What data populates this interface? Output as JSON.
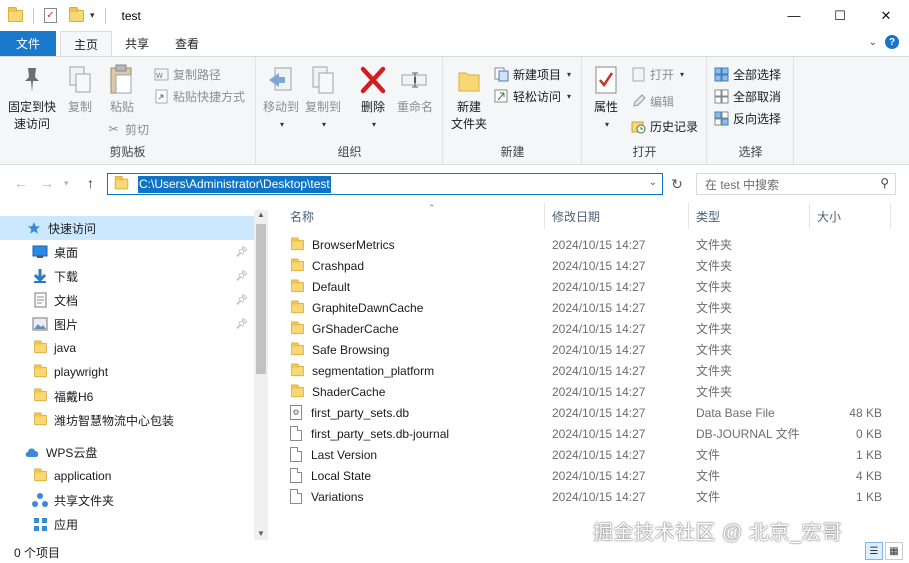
{
  "window": {
    "title": "test",
    "controls": {
      "minimize": "—",
      "maximize": "☐",
      "close": "✕"
    }
  },
  "ribbon_tabs": [
    {
      "label": "文件",
      "kind": "file"
    },
    {
      "label": "主页",
      "active": true
    },
    {
      "label": "共享"
    },
    {
      "label": "查看"
    }
  ],
  "ribbon": {
    "clipboard": {
      "group_label": "剪贴板",
      "pin_quick_access": "固定到快\n速访问",
      "copy": "复制",
      "paste": "粘贴",
      "copy_path": "复制路径",
      "paste_shortcut": "粘贴快捷方式",
      "cut": "剪切"
    },
    "organize": {
      "group_label": "组织",
      "move_to": "移动到",
      "copy_to": "复制到",
      "delete": "删除",
      "rename": "重命名"
    },
    "new": {
      "group_label": "新建",
      "new_folder": "新建\n文件夹",
      "new_item": "新建项目",
      "easy_access": "轻松访问"
    },
    "open": {
      "group_label": "打开",
      "properties": "属性",
      "open": "打开",
      "edit": "编辑",
      "history": "历史记录"
    },
    "select": {
      "group_label": "选择",
      "select_all": "全部选择",
      "select_none": "全部取消",
      "invert_selection": "反向选择"
    }
  },
  "address_bar": {
    "path": "C:\\Users\\Administrator\\Desktop\\test",
    "search_placeholder": "在 test 中搜索"
  },
  "nav_pane": {
    "items": [
      {
        "label": "快速访问",
        "icon": "star-icon",
        "selected": true,
        "indent": 0
      },
      {
        "label": "桌面",
        "icon": "desktop-icon",
        "pinned": true,
        "indent": 1
      },
      {
        "label": "下载",
        "icon": "download-icon",
        "pinned": true,
        "indent": 1
      },
      {
        "label": "文档",
        "icon": "document-icon",
        "pinned": true,
        "indent": 1
      },
      {
        "label": "图片",
        "icon": "pictures-icon",
        "pinned": true,
        "indent": 1
      },
      {
        "label": "java",
        "icon": "folder-icon",
        "indent": 1
      },
      {
        "label": "playwright",
        "icon": "folder-icon",
        "indent": 1
      },
      {
        "label": "福戴H6",
        "icon": "folder-icon",
        "indent": 1
      },
      {
        "label": "潍坊智慧物流中心包装",
        "icon": "folder-icon",
        "indent": 1
      },
      {
        "label": "WPS云盘",
        "icon": "cloud-icon",
        "indent": 0
      },
      {
        "label": "application",
        "icon": "folder-icon",
        "indent": 1
      },
      {
        "label": "共享文件夹",
        "icon": "share-folder-icon",
        "indent": 1
      },
      {
        "label": "应用",
        "icon": "apps-icon",
        "indent": 1
      }
    ]
  },
  "file_list": {
    "columns": {
      "name": "名称",
      "date": "修改日期",
      "type": "类型",
      "size": "大小"
    },
    "rows": [
      {
        "name": "BrowserMetrics",
        "date": "2024/10/15 14:27",
        "type": "文件夹",
        "size": "",
        "icon": "folder"
      },
      {
        "name": "Crashpad",
        "date": "2024/10/15 14:27",
        "type": "文件夹",
        "size": "",
        "icon": "folder"
      },
      {
        "name": "Default",
        "date": "2024/10/15 14:27",
        "type": "文件夹",
        "size": "",
        "icon": "folder"
      },
      {
        "name": "GraphiteDawnCache",
        "date": "2024/10/15 14:27",
        "type": "文件夹",
        "size": "",
        "icon": "folder"
      },
      {
        "name": "GrShaderCache",
        "date": "2024/10/15 14:27",
        "type": "文件夹",
        "size": "",
        "icon": "folder"
      },
      {
        "name": "Safe Browsing",
        "date": "2024/10/15 14:27",
        "type": "文件夹",
        "size": "",
        "icon": "folder"
      },
      {
        "name": "segmentation_platform",
        "date": "2024/10/15 14:27",
        "type": "文件夹",
        "size": "",
        "icon": "folder"
      },
      {
        "name": "ShaderCache",
        "date": "2024/10/15 14:27",
        "type": "文件夹",
        "size": "",
        "icon": "folder"
      },
      {
        "name": "first_party_sets.db",
        "date": "2024/10/15 14:27",
        "type": "Data Base File",
        "size": "48 KB",
        "icon": "db"
      },
      {
        "name": "first_party_sets.db-journal",
        "date": "2024/10/15 14:27",
        "type": "DB-JOURNAL 文件",
        "size": "0 KB",
        "icon": "file"
      },
      {
        "name": "Last Version",
        "date": "2024/10/15 14:27",
        "type": "文件",
        "size": "1 KB",
        "icon": "file"
      },
      {
        "name": "Local State",
        "date": "2024/10/15 14:27",
        "type": "文件",
        "size": "4 KB",
        "icon": "file"
      },
      {
        "name": "Variations",
        "date": "2024/10/15 14:27",
        "type": "文件",
        "size": "1 KB",
        "icon": "file"
      }
    ]
  },
  "status_bar": {
    "item_count": "0 个项目",
    "watermark": "掘金技术社区 @ 北京_宏哥"
  },
  "colors": {
    "accent": "#1979ca",
    "selected_bg": "#cce8ff",
    "folder": "#f8d775"
  }
}
